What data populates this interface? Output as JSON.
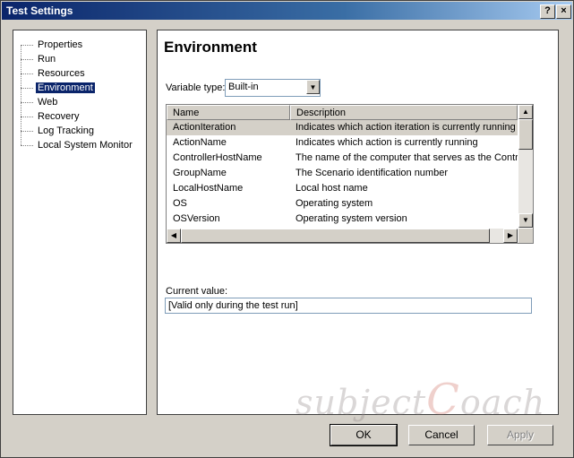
{
  "window": {
    "title": "Test Settings",
    "help_label": "?",
    "close_label": "×"
  },
  "tree": {
    "items": [
      {
        "label": "Properties"
      },
      {
        "label": "Run"
      },
      {
        "label": "Resources"
      },
      {
        "label": "Environment",
        "selected": true
      },
      {
        "label": "Web"
      },
      {
        "label": "Recovery"
      },
      {
        "label": "Log Tracking"
      },
      {
        "label": "Local System Monitor"
      }
    ]
  },
  "panel": {
    "heading": "Environment",
    "variable_type_label": "Variable type:",
    "variable_type_value": "Built-in",
    "current_value_label": "Current value:",
    "current_value": "[Valid only during the test run]"
  },
  "table": {
    "columns": [
      "Name",
      "Description"
    ],
    "rows": [
      {
        "name": "ActionIteration",
        "description": "Indicates which action iteration is currently running"
      },
      {
        "name": "ActionName",
        "description": "Indicates which action is currently running"
      },
      {
        "name": "ControllerHostName",
        "description": "The name of the computer that serves as the Controlle"
      },
      {
        "name": "GroupName",
        "description": "The Scenario identification number"
      },
      {
        "name": "LocalHostName",
        "description": "Local host name"
      },
      {
        "name": "OS",
        "description": "Operating system"
      },
      {
        "name": "OSVersion",
        "description": "Operating system version"
      }
    ]
  },
  "buttons": {
    "ok": "OK",
    "cancel": "Cancel",
    "apply": "Apply"
  },
  "watermark": {
    "part1": "subject",
    "part2": "C",
    "part3": "oach"
  },
  "colors": {
    "title_start": "#0a246a",
    "selection": "#0a246a",
    "face": "#d4d0c8"
  }
}
